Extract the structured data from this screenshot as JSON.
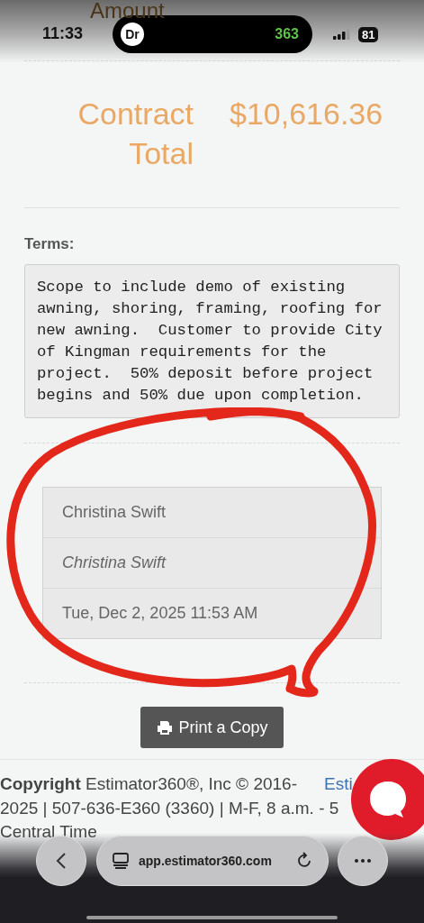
{
  "status_bar": {
    "time": "11:33",
    "island_badge": "Dr",
    "island_count": "363",
    "battery": "81"
  },
  "amount_heading": "Amount",
  "contract_total": {
    "label": "Contract Total",
    "value": "$10,616.36"
  },
  "terms": {
    "label": "Terms:",
    "text": "Scope to include demo of existing awning, shoring, framing, roofing for new awning.  Customer to provide City of Kingman requirements for the project.  50% deposit before project begins and 50% due upon completion."
  },
  "signature": [
    {
      "kind": "name",
      "text": "Christina Swift"
    },
    {
      "kind": "signature",
      "text": "Christina Swift"
    },
    {
      "kind": "date",
      "text": "Tue, Dec 2, 2025 11:53 AM"
    }
  ],
  "print_button": "Print a Copy",
  "footer": {
    "lines": [
      "**Copyright** Estimator360®, Inc © 2016-",
      "2025 | 507-636-E360 (3360) | M-F, 8 a.m. - 5",
      "Central Time"
    ],
    "link": "Esti"
  },
  "browser": {
    "url": "app.estimator360.com"
  }
}
